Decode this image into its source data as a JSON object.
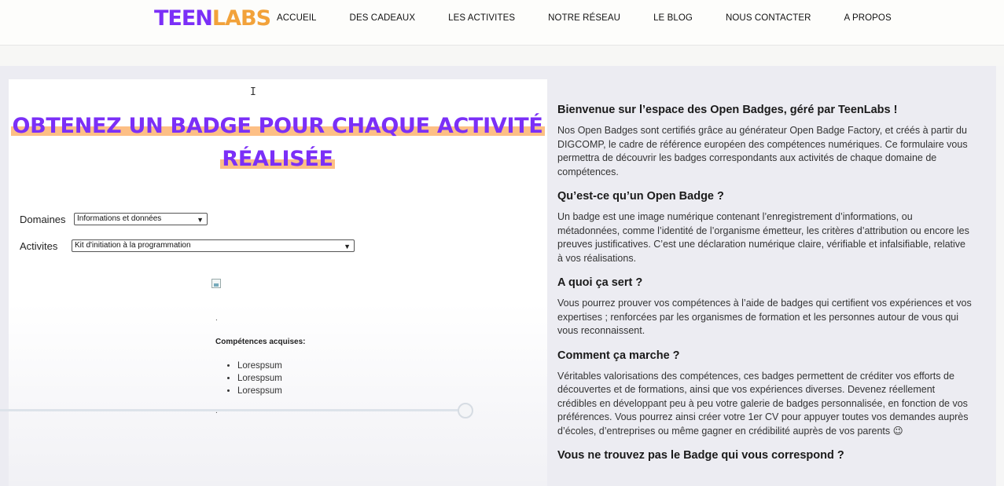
{
  "header": {
    "logo_teen": "TEEN",
    "logo_labs": "LABS",
    "nav": [
      "ACCUEIL",
      "DES CADEAUX",
      "LES ACTIVITES",
      "NOTRE RÉSEAU",
      "LE BLOG",
      "NOUS CONTACTER",
      "A PROPOS"
    ]
  },
  "main": {
    "title_line1": "OBTENEZ UN BADGE POUR CHAQUE ACTIVITÉ",
    "title_line2": "RÉALISÉE",
    "domaines_label": "Domaines",
    "domaines_value": "Informations et données",
    "activites_label": "Activites",
    "activites_value": "Kit d'initiation à la programmation",
    "dot1": ".",
    "competences_label": "Compétences acquises:",
    "competences": [
      "Lorespsum",
      "Lorespsum",
      "Lorespsum"
    ],
    "dot2": "."
  },
  "sidebar": {
    "sections": [
      {
        "heading": "Bienvenue sur l’espace des Open Badges, géré par TeenLabs !",
        "text": "Nos Open Badges sont certifiés grâce au générateur Open Badge Factory, et créés à partir du DIGCOMP, le cadre de référence européen des compétences numériques. Ce formulaire vous permettra de découvrir les badges correspondants aux activités de chaque domaine de compétences."
      },
      {
        "heading": "Qu’est-ce qu’un Open Badge ?",
        "text": "Un badge est une image numérique contenant l’enregistrement d’informations, ou métadonnées, comme l’identité de l’organisme émetteur, les critères d’attribution ou encore les preuves justificatives. C’est une déclaration numérique claire, vérifiable et infalsifiable, relative à vos réalisations."
      },
      {
        "heading": "A quoi ça sert ?",
        "text": "Vous pourrez prouver vos compétences à l’aide de badges qui certifient vos expériences et vos expertises ; renforcées par les organismes de formation et les personnes autour de vous qui vous reconnaissent."
      },
      {
        "heading": "Comment ça marche ?",
        "text": "Véritables valorisations des compétences, ces badges permettent de créditer vos efforts de découvertes et de formations, ainsi que vos expériences diverses. Devenez réellement crédibles en développant peu à peu votre galerie de badges personnalisée, en fonction de vos préférences. Vous pourrez ainsi créer votre 1er CV pour appuyer toutes vos demandes auprès d’écoles, d’entreprises ou même gagner en crédibilité auprès de vos parents 😉"
      },
      {
        "heading": "Vous ne trouvez pas le Badge qui vous correspond ?",
        "text": ""
      }
    ]
  },
  "colors": {
    "accent": "#7b2ff7",
    "highlight": "#fdbf85",
    "logo_orange": "#f2a23a"
  }
}
